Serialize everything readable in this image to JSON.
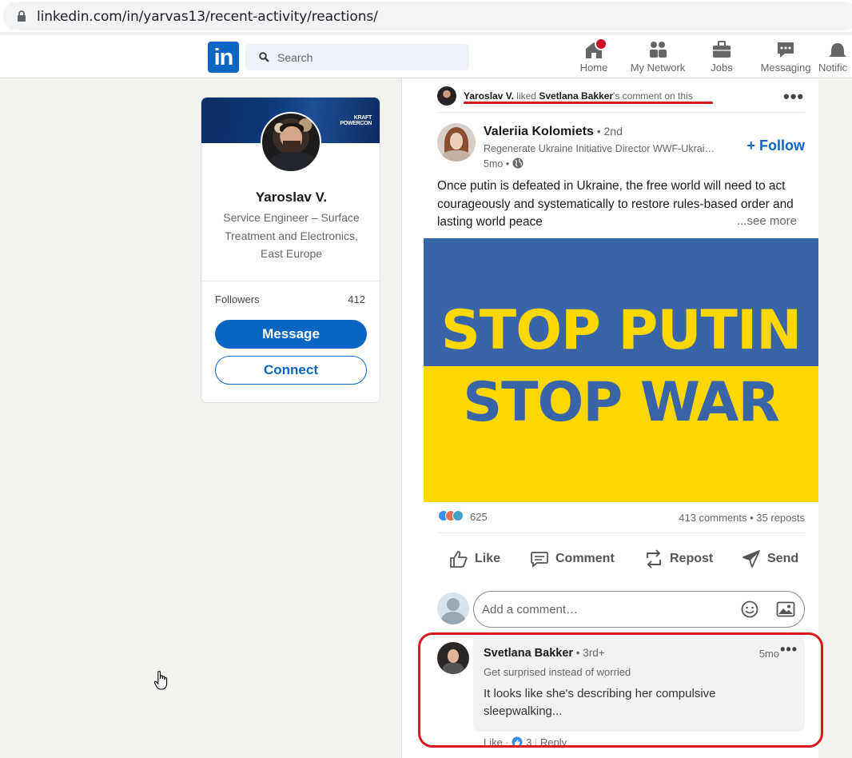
{
  "browser": {
    "url": "linkedin.com/in/yarvas13/recent-activity/reactions/"
  },
  "nav": {
    "logo_text": "in",
    "search_placeholder": "Search",
    "items": [
      {
        "label": "Home",
        "icon": "home-icon"
      },
      {
        "label": "My Network",
        "icon": "network-icon"
      },
      {
        "label": "Jobs",
        "icon": "briefcase-icon"
      },
      {
        "label": "Messaging",
        "icon": "messaging-icon"
      },
      {
        "label": "Notific",
        "icon": "bell-icon"
      }
    ]
  },
  "profile": {
    "banner_logo": "KRAFT\nPOWERCON",
    "name": "Yaroslav V.",
    "headline": "Service Engineer – Surface Treatment and Electronics, East Europe",
    "followers_label": "Followers",
    "followers_count": "412",
    "message_label": "Message",
    "connect_label": "Connect"
  },
  "post": {
    "activity": {
      "actor": "Yaroslav V.",
      "verb": " liked ",
      "target": "Svetlana Bakker",
      "suffix": "'s comment on this"
    },
    "author": {
      "name": "Valeriia Kolomiets",
      "degree": " • 2nd",
      "title": "Regenerate Ukraine Initiative Director WWF-Ukraine",
      "time": "5mo • "
    },
    "follow_label": "+ Follow",
    "text": "Once putin is defeated in Ukraine, the free world will need to act courageously and systematically to restore rules-based order and lasting world peace",
    "see_more": "...see more",
    "image": {
      "line1": "STOP PUTIN",
      "line2": "STOP WAR",
      "top_color": "#3a64a8",
      "bottom_color": "#fcd800"
    },
    "reaction_count": "625",
    "comments_reposts": "413 comments • 35 reposts",
    "actions": {
      "like": "Like",
      "comment": "Comment",
      "repost": "Repost",
      "send": "Send"
    },
    "comment_placeholder": "Add a comment…"
  },
  "comment": {
    "name": "Svetlana Bakker",
    "degree": " • 3rd+",
    "time": "5mo",
    "headline": "Get surprised instead of worried",
    "text": "It looks like she's describing her compulsive sleepwalking...",
    "like_label": "Like",
    "like_count": "3",
    "reply_label": "Reply"
  },
  "colors": {
    "brand": "#0a66c2",
    "highlight_red": "#d71920"
  }
}
